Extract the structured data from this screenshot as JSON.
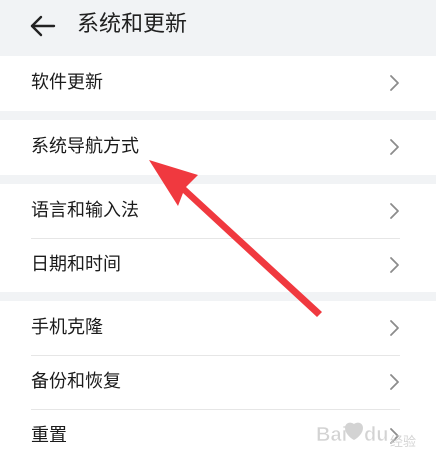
{
  "header": {
    "title": "系统和更新",
    "back_icon": "arrow-left-icon"
  },
  "settings": {
    "groups": [
      {
        "items": [
          {
            "label": "软件更新"
          }
        ]
      },
      {
        "items": [
          {
            "label": "系统导航方式"
          }
        ]
      },
      {
        "items": [
          {
            "label": "语言和输入法"
          },
          {
            "label": "日期和时间"
          }
        ]
      },
      {
        "items": [
          {
            "label": "手机克隆"
          },
          {
            "label": "备份和恢复"
          },
          {
            "label": "重置"
          }
        ]
      }
    ],
    "chevron_icon": "chevron-right-icon"
  },
  "annotation": {
    "color": "#f0393f",
    "icon": "red-pointer-arrow"
  },
  "watermark": {
    "text": "Baidu 经验",
    "brand_color": "#c9c9c9"
  }
}
